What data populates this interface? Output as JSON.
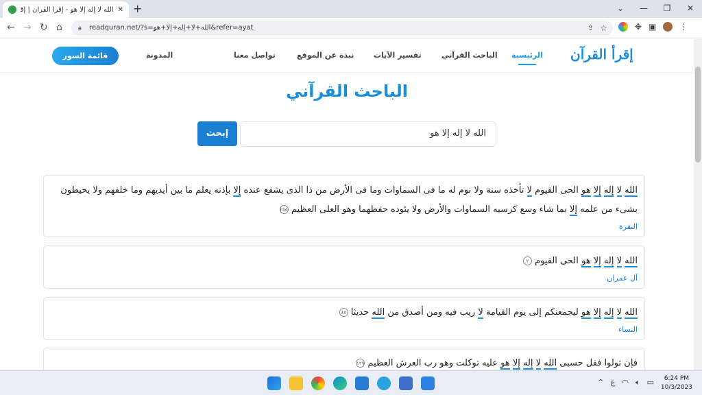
{
  "browser": {
    "tab_title": "الله لا إله إلا هو - إقرأ القرآن | إقرأ ال...",
    "new_tab_icon": "+",
    "url": "readquran.net/?s=الله+لا+إله+إلا+هو&refer=ayat",
    "controls": {
      "minimize": "—",
      "restore": "❐",
      "close": "✕",
      "tab_search": "⌄"
    }
  },
  "site": {
    "logo": "إقرأ القرآن",
    "nav": [
      {
        "label": "الرئيسية",
        "active": true
      },
      {
        "label": "الباحث القرآني",
        "active": false
      },
      {
        "label": "تفسير الآيات",
        "active": false
      },
      {
        "label": "نبذة عن الموقع",
        "active": false
      },
      {
        "label": "تواصل معنا",
        "active": false
      },
      {
        "label": "المدونة",
        "active": false
      }
    ],
    "surahs_button": "قائمة السور"
  },
  "search": {
    "heading": "الباحث القرآني",
    "query": "الله لا إله إلا هو",
    "button": "إبحث"
  },
  "results": [
    {
      "verse_html": "<span class='hl'>الله</span> <span class='hl'>لا</span> <span class='hl'>إله</span> <span class='hl'>إلا</span> <span class='hl'>هو</span> الحى القيوم <span class='hl'>لا</span> تأخذه سنة ولا نوم له ما فى السماوات وما فى الأرض من ذا الذى يشفع عنده <span class='hl'>إلا</span> بإذنه يعلم ما بين أيديهم وما خلفهم ولا يحيطون بشىء من علمه <span class='hl'>إلا</span> بما شاء وسع كرسيه السماوات والأرض ولا يئوده حفظهما وهو العلى العظيم",
      "verse_number": "٢٥٥",
      "surah": "البقرة"
    },
    {
      "verse_html": "<span class='hl'>الله</span> <span class='hl'>لا</span> <span class='hl'>إله</span> <span class='hl'>إلا</span> <span class='hl'>هو</span> الحى القيوم",
      "verse_number": "٢",
      "surah": "آل عمران"
    },
    {
      "verse_html": "<span class='hl'>الله</span> <span class='hl'>لا</span> <span class='hl'>إله</span> <span class='hl'>إلا</span> <span class='hl'>هو</span> ليجمعنكم إلى يوم القيامة <span class='hl'>لا</span> ريب فيه ومن أصدق من <span class='hl'>الله</span> حديثا",
      "verse_number": "٨٧",
      "surah": "النساء"
    },
    {
      "verse_html": "فإن تولوا فقل حسبى <span class='hl'>الله</span> <span class='hl'>لا</span> <span class='hl'>إله</span> <span class='hl'>إلا</span> <span class='hl'>هو</span> عليه توكلت وهو رب العرش العظيم",
      "verse_number": "١٢٩",
      "surah": ""
    }
  ],
  "taskbar": {
    "time": "6:24 PM",
    "date": "10/3/2023",
    "lang": "ع",
    "tray_up": "^"
  },
  "colors": {
    "accent": "#1a8fd8",
    "button": "#1a7fd0"
  }
}
